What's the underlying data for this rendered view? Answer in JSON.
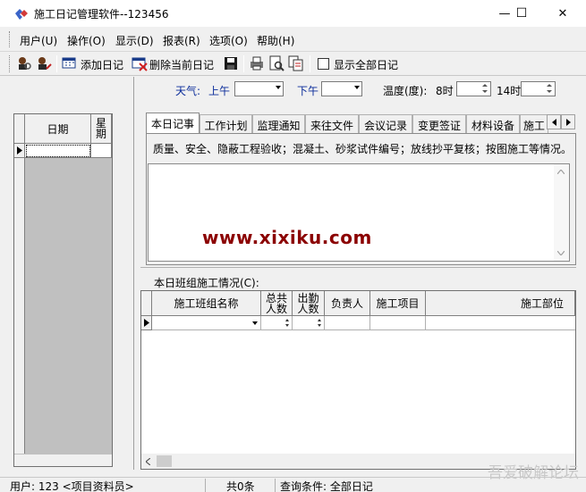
{
  "window": {
    "title": "施工日记管理软件--123456",
    "controls": {
      "minimize": "—",
      "maximize": "☐",
      "close": "✕"
    }
  },
  "menu": [
    "用户(U)",
    "操作(O)",
    "显示(D)",
    "报表(R)",
    "选项(O)",
    "帮助(H)"
  ],
  "toolbar": {
    "add_label": "添加日记",
    "delete_label": "删除当前日记",
    "show_all_label": "显示全部日记",
    "show_all_checked": false
  },
  "left_grid": {
    "headers": [
      "日期",
      "星\n期"
    ]
  },
  "weather": {
    "label": "天气:",
    "am_label": "上午",
    "am_value": "",
    "pm_label": "下午",
    "pm_value": "",
    "temp_label": "温度(度):",
    "temp_8_label": "8时",
    "temp_8_value": "",
    "temp_14_label": "14时",
    "temp_14_value": ""
  },
  "tabs": [
    "本日记事",
    "工作计划",
    "监理通知",
    "来往文件",
    "会议记录",
    "变更签证",
    "材料设备",
    "施工"
  ],
  "active_tab": 0,
  "tab_hint": "质量、安全、隐蔽工程验收；混凝土、砂浆试件编号；放线抄平复核；按图施工等情况。",
  "memo_value": "",
  "watermark": "www.xixiku.com",
  "crew_grid": {
    "title": "本日班组施工情况(C):",
    "headers": [
      "施工班组名称",
      "总共\n人数",
      "出勤\n人数",
      "负责人",
      "施工项目",
      "施工部位"
    ]
  },
  "status": {
    "user": "用户: 123 <项目资料员>",
    "count": "共0条",
    "query": "查询条件: 全部日记",
    "corner_watermark": "吾爱破解论坛"
  }
}
